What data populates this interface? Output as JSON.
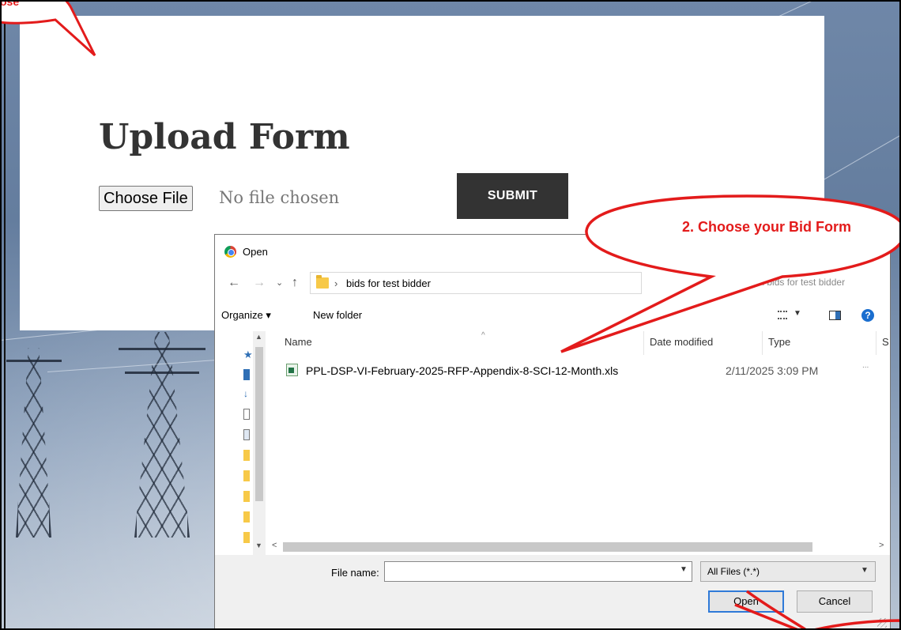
{
  "callouts": {
    "step1_fragment": "ose",
    "step2_text": "2. Choose your Bid Form"
  },
  "page": {
    "title": "Upload Form",
    "choose_file_label": "Choose File",
    "no_file_text": "No file chosen",
    "submit_label": "SUBMIT"
  },
  "dialog": {
    "title": "Open",
    "nav": {
      "back": "←",
      "forward": "→",
      "recent": "⌄",
      "up": "↑"
    },
    "breadcrumb_sep": "›",
    "breadcrumb": "bids for test bidder",
    "search_placeholder": "Search bids for test bidder",
    "toolbar": {
      "organize_label": "Organize ▾",
      "new_folder_label": "New folder"
    },
    "columns": {
      "name": "Name",
      "date_modified": "Date modified",
      "type": "Type",
      "size_partial": "S"
    },
    "files": [
      {
        "name": "PPL-DSP-VI-February-2025-RFP-Appendix-8-SCI-12-Month.xls",
        "date_modified": "2/11/2025 3:09 PM",
        "more": "..."
      }
    ],
    "file_name_label": "File name:",
    "file_name_value": "",
    "file_type": "All Files (*.*)",
    "open_label": "Open",
    "cancel_label": "Cancel",
    "help_label": "?"
  },
  "colors": {
    "callout_red": "#e31b1b",
    "submit_bg": "#333333",
    "open_focus": "#2f7ad8",
    "help_blue": "#1a6ecf"
  }
}
